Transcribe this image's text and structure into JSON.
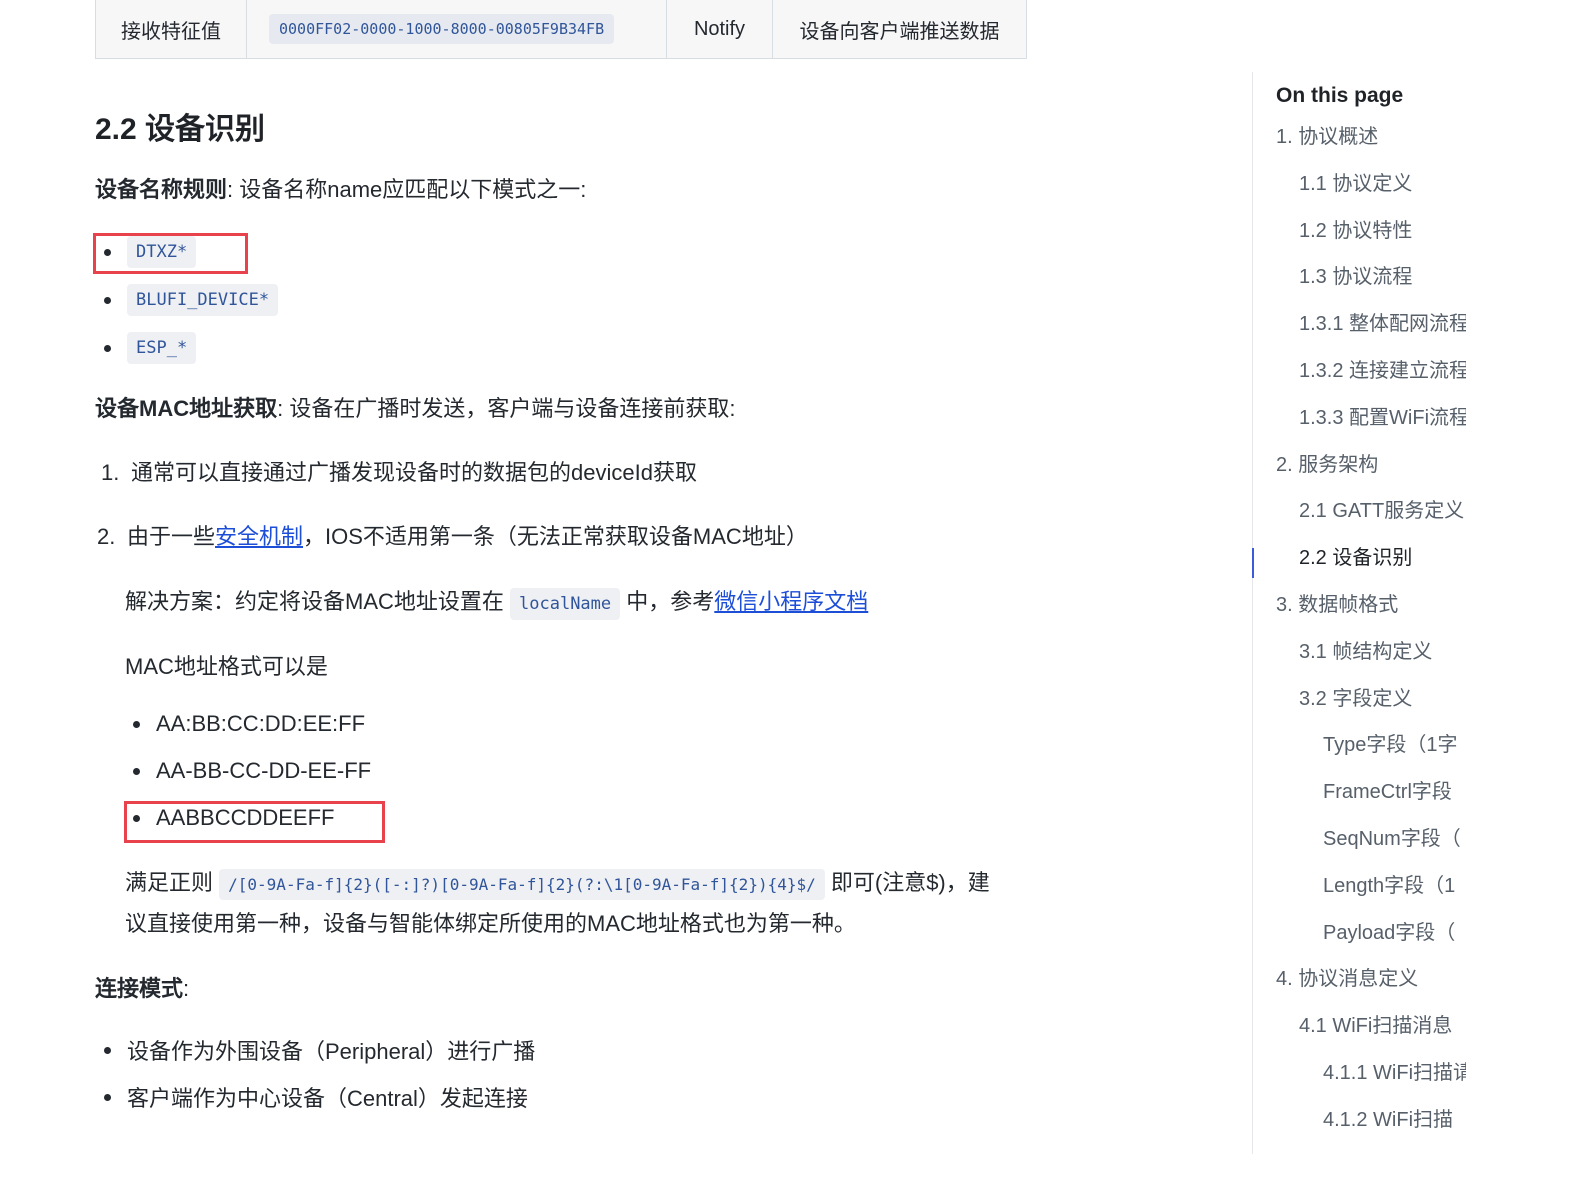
{
  "table_row": {
    "name": "接收特征值",
    "uuid": "0000FF02-0000-1000-8000-00805F9B34FB",
    "property": "Notify",
    "description": "设备向客户端推送数据"
  },
  "section": {
    "title": "2.2 设备识别",
    "name_rule_label": "设备名称规则",
    "name_rule_text": ": 设备名称name应匹配以下模式之一:",
    "name_patterns": [
      "DTXZ*",
      "BLUFI_DEVICE*",
      "ESP_*"
    ],
    "mac_label": "设备MAC地址获取",
    "mac_text": ": 设备在广播时发送，客户端与设备连接前获取:",
    "step1_num": "1.",
    "step1": "通常可以直接通过广播发现设备时的数据包的deviceId获取",
    "step2_num": "2.",
    "step2_pre": "由于一些",
    "step2_link": "安全机制",
    "step2_post": "，IOS不适用第一条（无法正常获取设备MAC地址）",
    "solution_pre": "解决方案：约定将设备MAC地址设置在",
    "solution_code": "localName",
    "solution_mid": "中，参考",
    "solution_link": "微信小程序文档",
    "mac_format_intro": "MAC地址格式可以是",
    "mac_formats": [
      "AA:BB:CC:DD:EE:FF",
      "AA-BB-CC-DD-EE-FF",
      "AABBCCDDEEFF"
    ],
    "regex_pre": "满足正则",
    "regex": "/[0-9A-Fa-f]{2}([-:]?)[0-9A-Fa-f]{2}(?:\\1[0-9A-Fa-f]{2}){4}$/",
    "regex_post": "即可(注意$)，建",
    "regex_line2": "议直接使用第一种，设备与智能体绑定所使用的MAC地址格式也为第一种。",
    "conn_label": "连接模式",
    "conn_colon": ":",
    "conn_items": [
      "设备作为外围设备（Peripheral）进行广播",
      "客户端作为中心设备（Central）发起连接"
    ]
  },
  "toc": {
    "title": "On this page",
    "items": [
      {
        "label": "1. 协议概述",
        "level": 1
      },
      {
        "label": "1.1 协议定义",
        "level": 2
      },
      {
        "label": "1.2 协议特性",
        "level": 2
      },
      {
        "label": "1.3 协议流程",
        "level": 2
      },
      {
        "label": "1.3.1 整体配网流程",
        "level": 2
      },
      {
        "label": "1.3.2 连接建立流程",
        "level": 2
      },
      {
        "label": "1.3.3 配置WiFi流程",
        "level": 2
      },
      {
        "label": "2. 服务架构",
        "level": 1
      },
      {
        "label": "2.1 GATT服务定义",
        "level": 2
      },
      {
        "label": "2.2 设备识别",
        "level": 2,
        "active": true
      },
      {
        "label": "3. 数据帧格式",
        "level": 1
      },
      {
        "label": "3.1 帧结构定义",
        "level": 2
      },
      {
        "label": "3.2 字段定义",
        "level": 2
      },
      {
        "label": "Type字段（1字",
        "level": 3
      },
      {
        "label": "FrameCtrl字段",
        "level": 3
      },
      {
        "label": "SeqNum字段（",
        "level": 3
      },
      {
        "label": "Length字段（1",
        "level": 3
      },
      {
        "label": "Payload字段（",
        "level": 3
      },
      {
        "label": "4. 协议消息定义",
        "level": 1
      },
      {
        "label": "4.1 WiFi扫描消息",
        "level": 2
      },
      {
        "label": "4.1.1 WiFi扫描请",
        "level": 3
      },
      {
        "label": "4.1.2 WiFi扫描",
        "level": 3
      }
    ]
  }
}
